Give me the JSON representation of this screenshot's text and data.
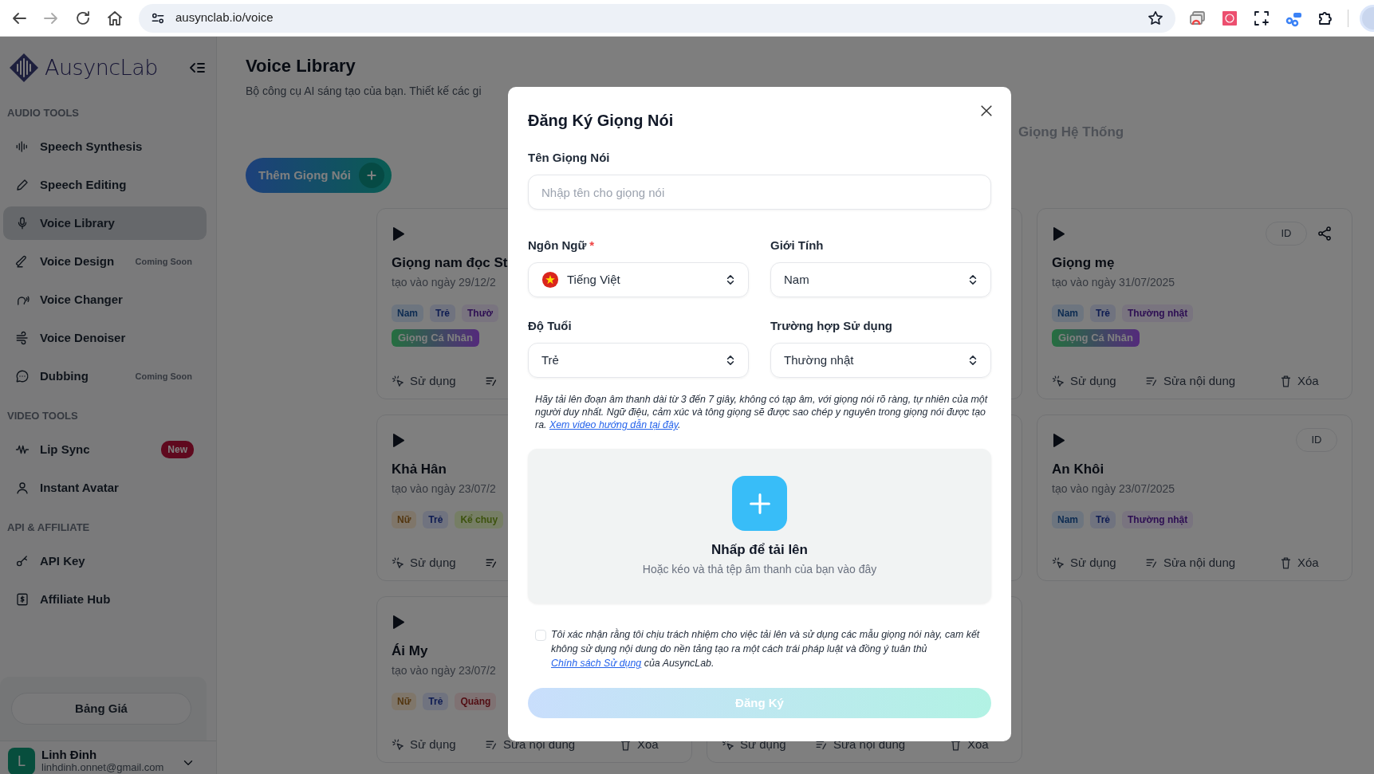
{
  "browser": {
    "url": "ausynclab.io/voice"
  },
  "sidebar": {
    "logo": "AusyncLab",
    "sections": [
      {
        "heading": "AUDIO TOOLS",
        "items": [
          {
            "label": "Speech Synthesis",
            "selected": false
          },
          {
            "label": "Speech Editing",
            "selected": false
          },
          {
            "label": "Voice Library",
            "selected": true
          },
          {
            "label": "Voice Design",
            "selected": false,
            "tag": {
              "kind": "note",
              "text": "Coming Soon"
            }
          },
          {
            "label": "Voice Changer",
            "selected": false
          },
          {
            "label": "Voice Denoiser",
            "selected": false
          },
          {
            "label": "Dubbing",
            "selected": false,
            "tag": {
              "kind": "note",
              "text": "Coming Soon"
            }
          }
        ]
      },
      {
        "heading": "VIDEO TOOLS",
        "items": [
          {
            "label": "Lip Sync",
            "selected": false,
            "tag": {
              "kind": "badge",
              "text": "New"
            }
          },
          {
            "label": "Instant Avatar",
            "selected": false
          }
        ]
      },
      {
        "heading": "API & AFFILIATE",
        "items": [
          {
            "label": "API Key",
            "selected": false
          },
          {
            "label": "Affiliate Hub",
            "selected": false
          }
        ]
      }
    ],
    "pricing_button": "Bảng Giá",
    "user": {
      "initial": "L",
      "name": "Linh Đinh",
      "email": "linhdinh.onnet@gmail.com"
    }
  },
  "page": {
    "title": "Voice Library",
    "subtitle": "Bộ công cụ AI sáng tạo của bạn. Thiết kế các gi",
    "tabs": [
      {
        "label": "Giọng Hệ Thống",
        "selected": false
      }
    ],
    "add_button": "Thêm Giọng Nói"
  },
  "cards": [
    {
      "kind": "voice",
      "title": "Giọng nam đọc St",
      "date": "tạo vào ngày 29/12/2",
      "tags": [
        {
          "text": "Nam",
          "color": "#6d757f"
        },
        {
          "text": "Trẻ",
          "color": "#70737f"
        },
        {
          "text": "Thườ",
          "color": "#79747f"
        }
      ],
      "badge": "Giọng Cá Nhân",
      "actions": [
        {
          "kind": "use",
          "label": "Sử dụng"
        },
        {
          "kind": "edit"
        }
      ]
    },
    {
      "kind": "covered"
    },
    {
      "kind": "voice",
      "id_label": "ID",
      "share": true,
      "title": "Giọng mẹ",
      "date": "tạo vào ngày 31/07/2025",
      "tags": [
        {
          "text": "Nam",
          "color": "#6d757f"
        },
        {
          "text": "Trẻ",
          "color": "#70737f"
        },
        {
          "text": "Thường nhật",
          "color": "#79747f"
        }
      ],
      "badge": "Giọng Cá Nhân",
      "actions": [
        {
          "kind": "use",
          "label": "Sử dụng"
        },
        {
          "kind": "edit",
          "label": "Sửa nội dung"
        },
        {
          "kind": "delete",
          "label": "Xóa"
        }
      ]
    },
    {
      "kind": "voice",
      "title": "Khả Hân",
      "date": "tạo vào ngày 23/07/2",
      "tags": [
        {
          "text": "Nữ",
          "color": "#7f766a"
        },
        {
          "text": "Trẻ",
          "color": "#70737f"
        },
        {
          "text": "Kể chuy",
          "color": "#767e65"
        }
      ],
      "actions": [
        {
          "kind": "use",
          "label": "Sử dụng"
        },
        {
          "kind": "edit"
        }
      ]
    },
    {
      "kind": "covered"
    },
    {
      "kind": "voice",
      "id_label": "ID",
      "title": "An Khôi",
      "date": "tạo vào ngày 23/07/2025",
      "tags": [
        {
          "text": "Nam",
          "color": "#6d757f"
        },
        {
          "text": "Trẻ",
          "color": "#70737f"
        },
        {
          "text": "Thường nhật",
          "color": "#79747f"
        }
      ],
      "actions": [
        {
          "kind": "use",
          "label": "Sử dụng"
        },
        {
          "kind": "edit",
          "label": "Sửa nội dung"
        },
        {
          "kind": "delete",
          "label": "Xóa"
        }
      ]
    },
    {
      "kind": "voice",
      "title": "Ái My",
      "date": "tạo vào ngày 23/07/2",
      "tags": [
        {
          "text": "Nữ",
          "color": "#7f766a"
        },
        {
          "text": "Trẻ",
          "color": "#70737f"
        },
        {
          "text": "Quảng",
          "color": "#7f7273"
        }
      ],
      "actions": [
        {
          "kind": "use",
          "label": "Sử dụng"
        },
        {
          "kind": "edit",
          "label": "Sửa nội dung"
        },
        {
          "kind": "delete",
          "label": "Xóa"
        }
      ]
    },
    {
      "kind": "covered",
      "actions": [
        {
          "kind": "use",
          "label": "Sử dụng"
        },
        {
          "kind": "edit",
          "label": "Sửa nội dung"
        },
        {
          "kind": "delete",
          "label": "Xóa"
        }
      ]
    }
  ],
  "modal": {
    "title": "Đăng Ký Giọng Nói",
    "name_label": "Tên Giọng Nói",
    "name_placeholder": "Nhập tên cho giọng nói",
    "fields": [
      {
        "label": "Ngôn Ngữ",
        "required_mark": "*",
        "flag": true,
        "value": "Tiếng Việt"
      },
      {
        "label": "Giới Tính",
        "value": "Nam"
      },
      {
        "label": "Độ Tuổi",
        "value": "Trẻ"
      },
      {
        "label": "Trường hợp Sử dụng",
        "value": "Thường nhật"
      }
    ],
    "note": {
      "text": "Hãy tải lên đoạn âm thanh dài từ 3 đến 7 giây, không có tạp âm, với giọng nói rõ ràng, tự nhiên của một người duy nhất. Ngữ điệu, cảm xúc và tông giọng sẽ được sao chép y nguyên trong giọng nói được tạo ra.",
      "link": "Xem video hướng dẫn tại đây",
      "end": "."
    },
    "upload": {
      "title": "Nhấp để tải lên",
      "hint": "Hoặc kéo và thả tệp âm thanh của bạn vào đây"
    },
    "consent": {
      "checked": false,
      "text": "Tôi xác nhận rằng tôi chịu trách nhiệm cho việc tải lên và sử dụng các mẫu giọng nói này, cam kết không sử dụng nội dung do nền tảng tạo ra một cách trái pháp luật và đồng ý tuân thủ",
      "link": "Chính sách Sử dụng",
      "end": "của AusyncLab."
    },
    "submit": {
      "label": "Đăng Ký",
      "disabled": true
    }
  }
}
